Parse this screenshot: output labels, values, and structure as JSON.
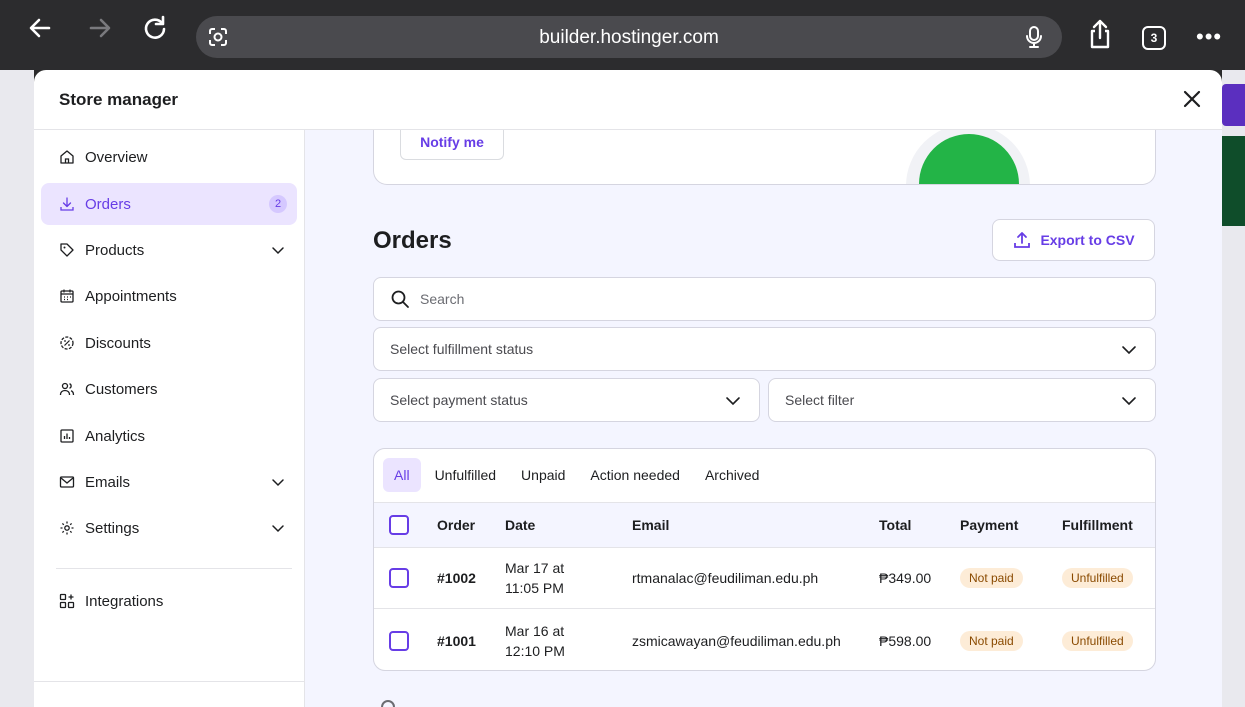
{
  "browser": {
    "url": "builder.hostinger.com",
    "tab_count": "3",
    "more_label": "•••"
  },
  "modal": {
    "title": "Store manager"
  },
  "sidebar": {
    "items": [
      {
        "label": "Overview",
        "icon": "home-icon"
      },
      {
        "label": "Orders",
        "icon": "download-icon",
        "badge": "2",
        "active": true
      },
      {
        "label": "Products",
        "icon": "tag-icon",
        "expandable": true
      },
      {
        "label": "Appointments",
        "icon": "calendar-icon"
      },
      {
        "label": "Discounts",
        "icon": "discount-icon"
      },
      {
        "label": "Customers",
        "icon": "users-icon"
      },
      {
        "label": "Analytics",
        "icon": "chart-icon"
      },
      {
        "label": "Emails",
        "icon": "mail-icon",
        "expandable": true
      },
      {
        "label": "Settings",
        "icon": "gear-icon",
        "expandable": true
      },
      {
        "label": "Integrations",
        "icon": "grid-plus-icon"
      }
    ]
  },
  "promo": {
    "notify_label": "Notify me"
  },
  "orders": {
    "title": "Orders",
    "export_label": "Export to CSV",
    "search_placeholder": "Search",
    "fulfillment_select": "Select fulfillment status",
    "payment_select": "Select payment status",
    "filter_select": "Select filter",
    "tabs": [
      "All",
      "Unfulfilled",
      "Unpaid",
      "Action needed",
      "Archived"
    ],
    "columns": {
      "order": "Order",
      "date": "Date",
      "email": "Email",
      "total": "Total",
      "payment": "Payment",
      "fulfillment": "Fulfillment"
    },
    "rows": [
      {
        "order": "#1002",
        "date_line1": "Mar 17 at",
        "date_line2": "11:05 PM",
        "email": "rtmanalac@feudiliman.edu.ph",
        "total": "₱349.00",
        "payment": "Not paid",
        "fulfillment": "Unfulfilled"
      },
      {
        "order": "#1001",
        "date_line1": "Mar 16 at",
        "date_line2": "12:10 PM",
        "email": "zsmicawayan@feudiliman.edu.ph",
        "total": "₱598.00",
        "payment": "Not paid",
        "fulfillment": "Unfulfilled"
      }
    ]
  },
  "colors": {
    "accent": "#673de6",
    "accent_light": "#ebe4ff",
    "pill_bg": "#fdecd7",
    "page_bg": "#f4f5ff"
  }
}
